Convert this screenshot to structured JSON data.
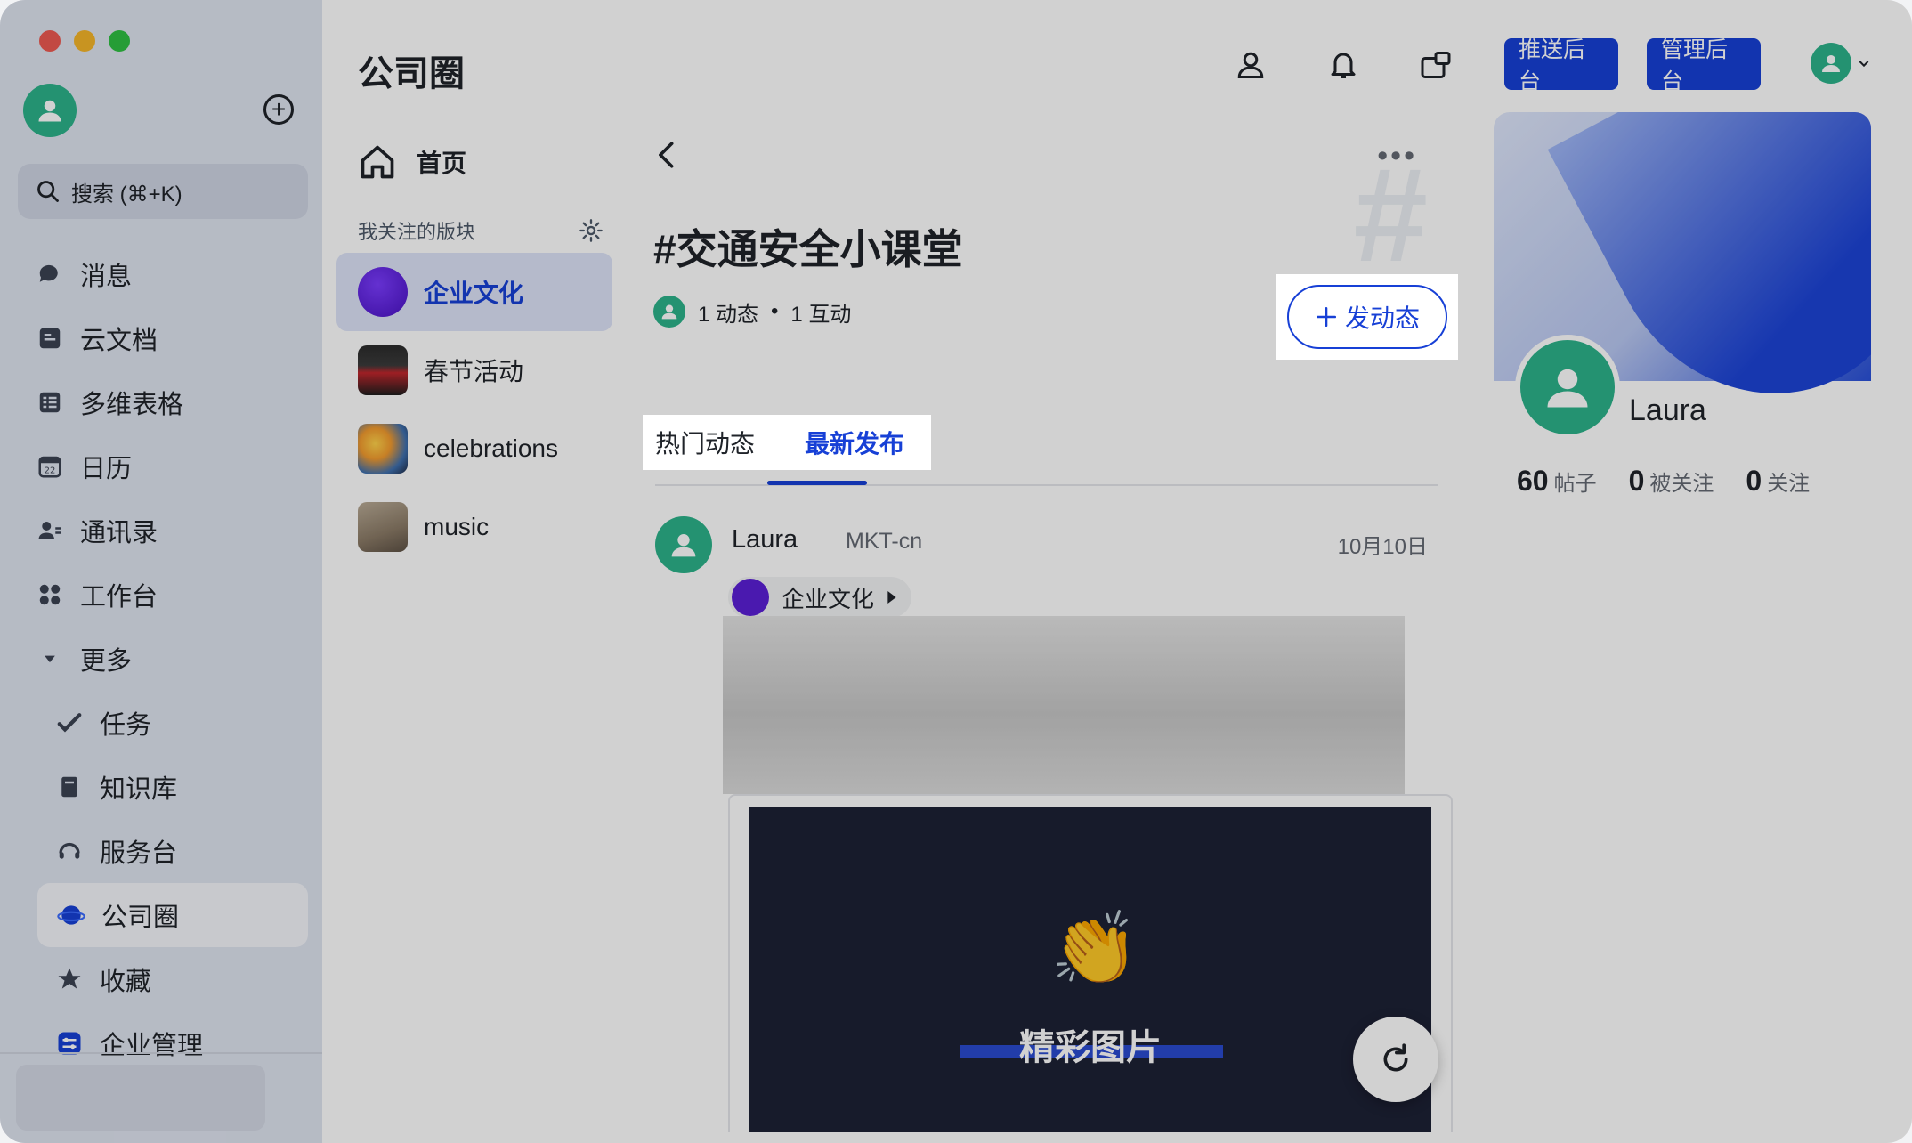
{
  "window": {
    "traffic_colors": [
      "#ed5a51",
      "#f5b529",
      "#2fc043"
    ]
  },
  "sidebar": {
    "search_placeholder": "搜索 (⌘+K)",
    "items": [
      {
        "label": "消息",
        "icon": "chat-icon"
      },
      {
        "label": "云文档",
        "icon": "doc-icon"
      },
      {
        "label": "多维表格",
        "icon": "table-icon"
      },
      {
        "label": "日历",
        "icon": "calendar-icon"
      },
      {
        "label": "通讯录",
        "icon": "contacts-icon"
      },
      {
        "label": "工作台",
        "icon": "apps-icon"
      },
      {
        "label": "更多",
        "icon": "caret-down-icon"
      },
      {
        "label": "任务",
        "icon": "check-icon"
      },
      {
        "label": "知识库",
        "icon": "book-icon"
      },
      {
        "label": "服务台",
        "icon": "headset-icon"
      },
      {
        "label": "公司圈",
        "icon": "planet-icon"
      },
      {
        "label": "收藏",
        "icon": "star-icon"
      },
      {
        "label": "企业管理",
        "icon": "admin-icon"
      }
    ],
    "calendar_day": "22"
  },
  "header": {
    "title": "公司圈",
    "push_admin": "推送后台",
    "manage_admin": "管理后台"
  },
  "sections": {
    "home": "首页",
    "followed_label": "我关注的版块",
    "items": [
      {
        "label": "企业文化"
      },
      {
        "label": "春节活动"
      },
      {
        "label": "celebrations"
      },
      {
        "label": "music"
      }
    ]
  },
  "topic": {
    "title": "#交通安全小课堂",
    "posts_count": "1 动态",
    "separator": "•",
    "interactions": "1 互动",
    "post_button": "发动态"
  },
  "feed": {
    "tabs": [
      "热门动态",
      "最新发布"
    ],
    "active_tab": 1,
    "post": {
      "author": "Laura",
      "dept": "MKT-cn",
      "date": "10月10日",
      "tag": "企业文化",
      "image_caption": "精彩图片"
    }
  },
  "profile": {
    "name": "Laura",
    "posts_num": "60",
    "posts_label": "帖子",
    "followers_num": "0",
    "followers_label": "被关注",
    "following_num": "0",
    "following_label": "关注"
  },
  "colors": {
    "accent": "#1740d6",
    "avatar": "#2cb38a"
  }
}
